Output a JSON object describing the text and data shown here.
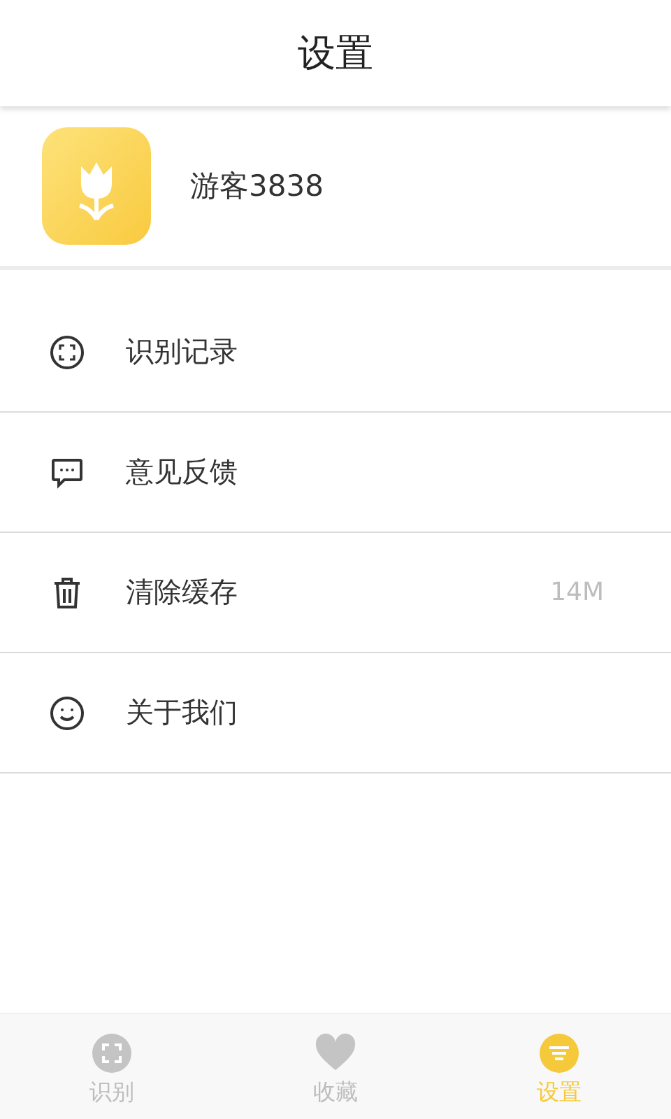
{
  "header": {
    "title": "设置"
  },
  "profile": {
    "name": "游客3838"
  },
  "menu": [
    {
      "kind": "scan",
      "label": "识别记录"
    },
    {
      "kind": "chat",
      "label": "意见反馈"
    },
    {
      "kind": "trash",
      "label": "清除缓存",
      "value": "14M"
    },
    {
      "kind": "smile",
      "label": "关于我们"
    }
  ],
  "tabs": [
    {
      "kind": "scan",
      "label": "识别",
      "selected": false
    },
    {
      "kind": "heart",
      "label": "收藏",
      "selected": false
    },
    {
      "kind": "list",
      "label": "设置",
      "selected": true
    }
  ]
}
